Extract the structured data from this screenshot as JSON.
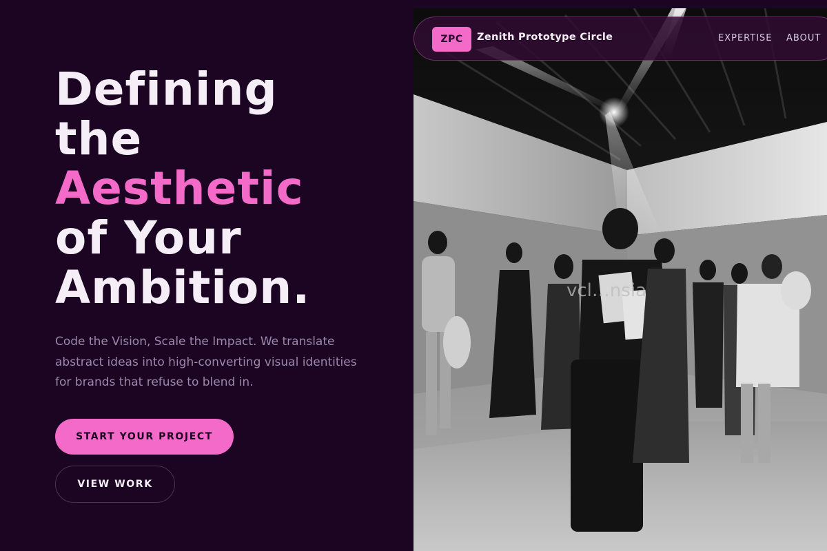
{
  "nav": {
    "logo_badge": "ZPC",
    "brand_name": "Zenith Prototype Circle",
    "links": [
      "EXPERTISE",
      "ABOUT"
    ]
  },
  "hero": {
    "headline_lines": [
      "Defining",
      "the",
      "Aesthetic",
      "of Your",
      "Ambition."
    ],
    "accent_line_index": 2,
    "subtext": "Code the Vision, Scale the Impact. We translate abstract ideas into high-converting visual identities for brands that refuse to blend in.",
    "primary_cta": "START YOUR PROJECT",
    "secondary_cta": "VIEW WORK"
  },
  "photo": {
    "watermark": "vcl…nsia",
    "description_icon": "fashion-show-photo"
  },
  "colors": {
    "background": "#1c0423",
    "accent": "#f46ac9",
    "text": "#f5eef7",
    "muted": "#9a88ad"
  }
}
